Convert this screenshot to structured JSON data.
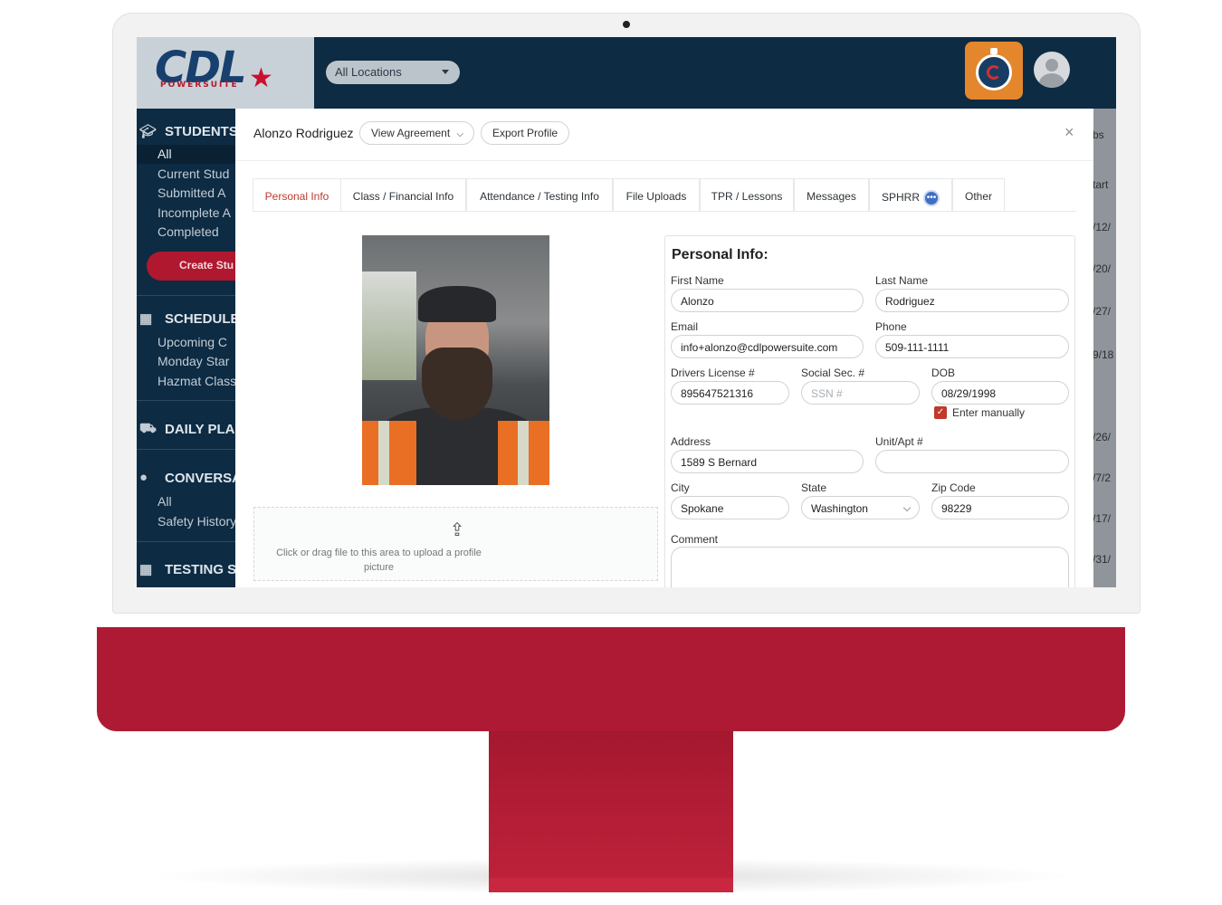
{
  "app": {
    "logo_text": "CDL",
    "logo_sub": "POWERSUITE",
    "location_select": "All Locations"
  },
  "sidebar": {
    "students": {
      "title": "STUDENTS",
      "items": [
        "All",
        "Current Stud",
        "Submitted A",
        "Incomplete A",
        "Completed"
      ],
      "create_label": "Create Stu"
    },
    "schedule": {
      "title": "SCHEDULE",
      "items": [
        "Upcoming C",
        "Monday Star",
        "Hazmat Class"
      ]
    },
    "daily": {
      "title": "DAILY PLA"
    },
    "conversations": {
      "title": "CONVERSA",
      "items": [
        "All",
        "Safety History"
      ]
    },
    "testing": {
      "title": "TESTING S"
    }
  },
  "peek": {
    "top": "bs",
    "header": "tart",
    "dates": [
      "/12/",
      "/20/",
      "/27/",
      "9/18",
      "/26/",
      "/7/2",
      "/17/",
      "/31/"
    ]
  },
  "modal": {
    "student_name": "Alonzo Rodriguez",
    "view_agreement": "View Agreement",
    "export_profile": "Export Profile",
    "close": "×",
    "tabs": [
      "Personal Info",
      "Class / Financial Info",
      "Attendance / Testing Info",
      "File Uploads",
      "TPR / Lessons",
      "Messages",
      "SPHRR",
      "Other"
    ],
    "upload_text": "Click or drag file to this area to upload a profile picture",
    "form": {
      "title": "Personal Info:",
      "first_name_label": "First Name",
      "first_name": "Alonzo",
      "last_name_label": "Last Name",
      "last_name": "Rodriguez",
      "email_label": "Email",
      "email": "info+alonzo@cdlpowersuite.com",
      "phone_label": "Phone",
      "phone": "509-111-1111",
      "license_label": "Drivers License #",
      "license": "895647521316",
      "ssn_label": "Social Sec. #",
      "ssn_placeholder": "SSN #",
      "dob_label": "DOB",
      "dob": "08/29/1998",
      "enter_manually": "Enter manually",
      "address_label": "Address",
      "address": "1589 S Bernard",
      "unit_label": "Unit/Apt #",
      "unit": "",
      "city_label": "City",
      "city": "Spokane",
      "state_label": "State",
      "state": "Washington",
      "zip_label": "Zip Code",
      "zip": "98229",
      "comment_label": "Comment"
    }
  },
  "colors": {
    "brand_navy": "#0d2b43",
    "brand_red": "#ae1a33",
    "accent_orange": "#e4862c",
    "active_tab": "#c0392b"
  }
}
